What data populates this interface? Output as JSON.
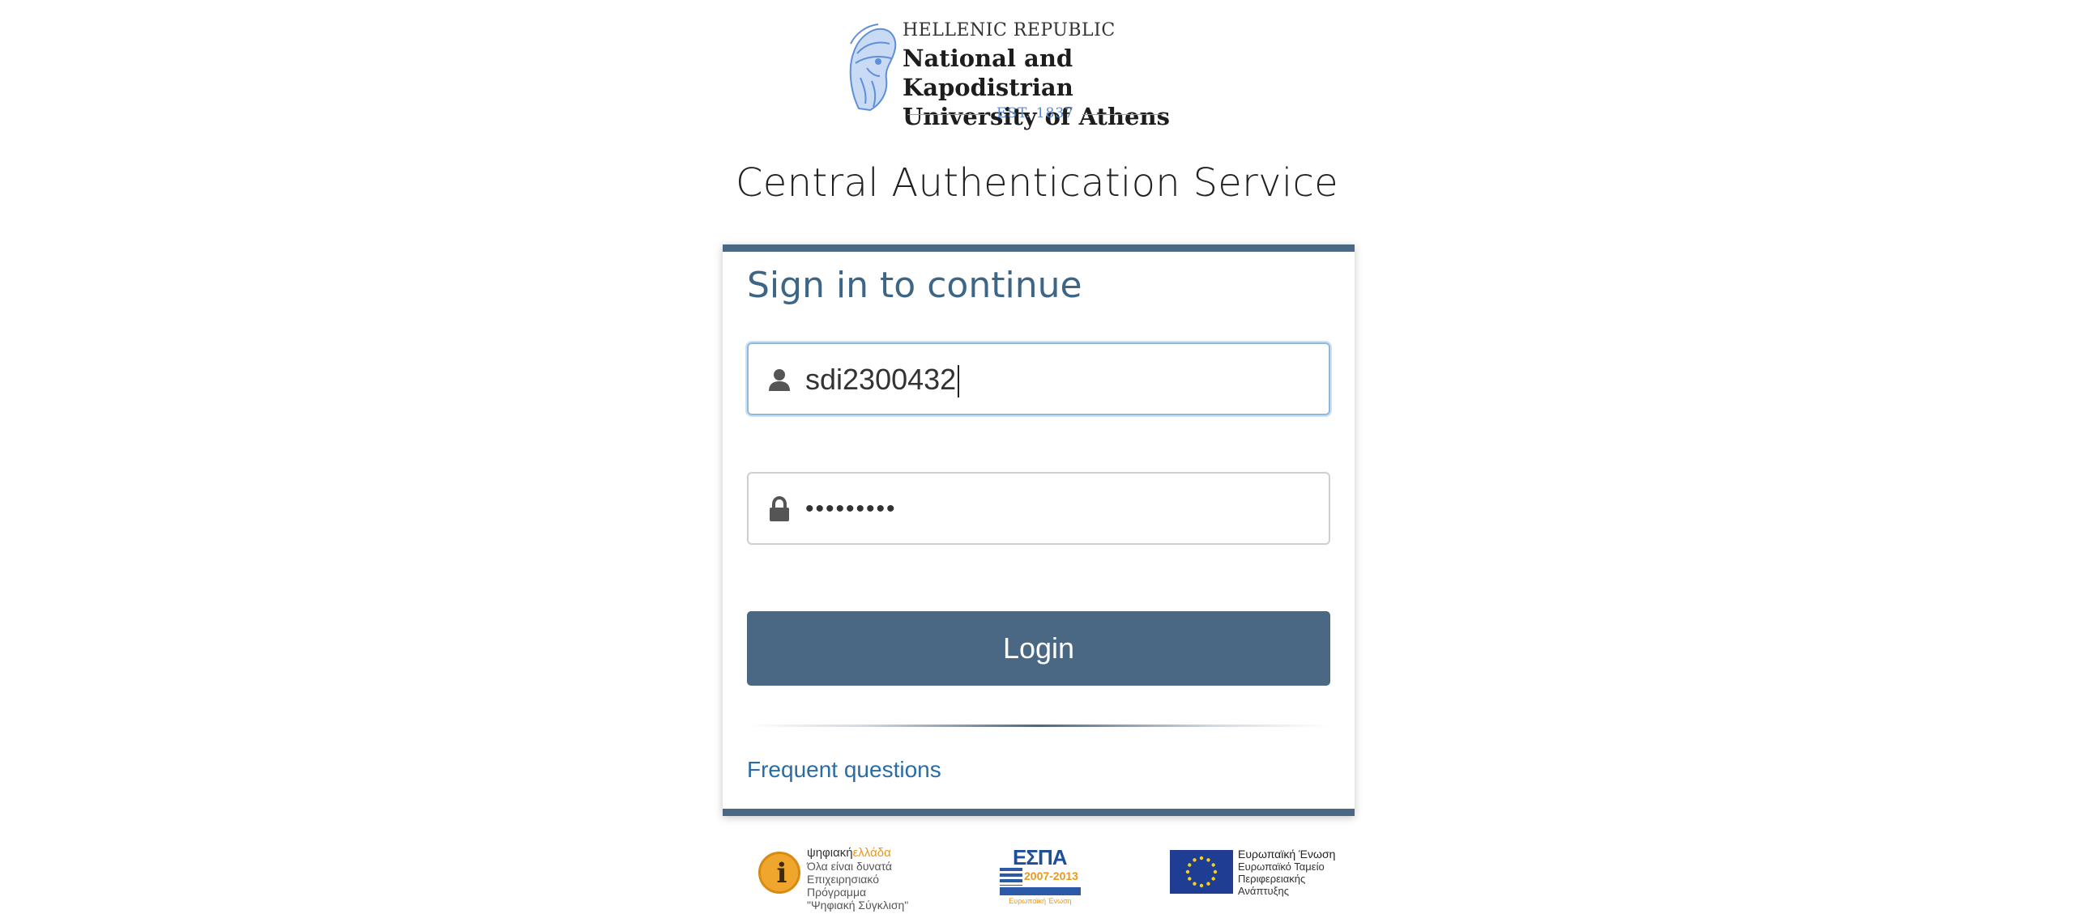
{
  "header": {
    "republic": "HELLENIC REPUBLIC",
    "university_line1": "National and Kapodistrian",
    "university_line2": "University of Athens",
    "established": "EST. 1837",
    "emblem_icon": "athena-emblem-icon"
  },
  "service_title": "Central Authentication Service",
  "login_form": {
    "heading": "Sign in to continue",
    "username": {
      "value": "sdi2300432",
      "icon": "user-icon"
    },
    "password": {
      "value": "•••••••••",
      "icon": "lock-icon"
    },
    "submit_label": "Login",
    "faq_link": "Frequent questions"
  },
  "footer_logos": {
    "digital_greece": {
      "brand_prefix": "ψηφιακή",
      "brand_suffix": "ελλάδα",
      "line1": "Όλα είναι δυνατά",
      "line2": "Επιχειρησιακό Πρόγραμμα",
      "line3": "\"Ψηφιακή Σύγκλιση\""
    },
    "espa": {
      "title": "ΕΣΠΑ",
      "years": "2007-2013",
      "subtitle": "Ευρωπαϊκή Ένωση"
    },
    "eu": {
      "line1": "Ευρωπαϊκή Ένωση",
      "line2": "Ευρωπαϊκό Ταμείο",
      "line3": "Περιφερειακής",
      "line4": "Ανάπτυξης"
    }
  },
  "colors": {
    "accent": "#4a6883",
    "heading": "#3d6586",
    "link": "#2b6ca6",
    "focus_border": "#8fb9de",
    "eu_blue": "#1f3d93",
    "espa_orange": "#e89a1c"
  }
}
